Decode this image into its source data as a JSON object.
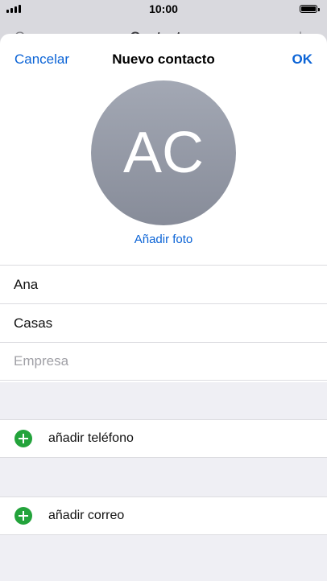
{
  "status": {
    "time": "10:00"
  },
  "behind_nav": {
    "left": "Grupos",
    "title": "Contactos",
    "right": "+"
  },
  "nav": {
    "cancel": "Cancelar",
    "title": "Nuevo contacto",
    "ok": "OK"
  },
  "avatar": {
    "initials": "AC",
    "add_photo": "Añadir foto"
  },
  "fields": [
    {
      "value": "Ana",
      "placeholder": ""
    },
    {
      "value": "Casas",
      "placeholder": ""
    },
    {
      "value": "",
      "placeholder": "Empresa"
    }
  ],
  "actions": {
    "add_phone": "añadir teléfono",
    "add_email": "añadir correo"
  },
  "colors": {
    "accent": "#0a63d6",
    "add_green": "#23a33b",
    "avatar_gray": "#8d929e"
  }
}
